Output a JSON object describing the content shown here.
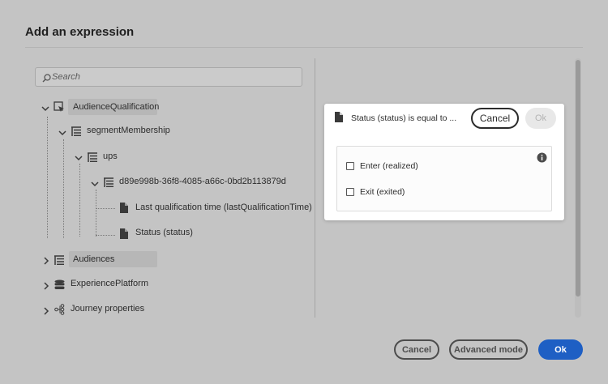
{
  "dialog": {
    "title": "Add an expression"
  },
  "search": {
    "placeholder": "Search"
  },
  "tree": {
    "audience_qualification": "AudienceQualification",
    "segment_membership": "segmentMembership",
    "ups": "ups",
    "segment_id": "d89e998b-36f8-4085-a66c-0bd2b113879d",
    "last_qualification_time": "Last qualification time (lastQualificationTime)",
    "status": "Status (status)",
    "audiences": "Audiences",
    "experience_platform": "ExperiencePlatform",
    "journey_properties": "Journey properties"
  },
  "popover": {
    "title": "Status (status) is equal to ...",
    "cancel_label": "Cancel",
    "ok_label": "Ok",
    "options": [
      {
        "label": "Enter (realized)",
        "checked": false
      },
      {
        "label": "Exit (exited)",
        "checked": false
      }
    ]
  },
  "footer": {
    "cancel_label": "Cancel",
    "advanced_label": "Advanced mode",
    "ok_label": "Ok"
  },
  "colors": {
    "backdrop": "#c4c4c4",
    "primary": "#1e5fc4"
  }
}
